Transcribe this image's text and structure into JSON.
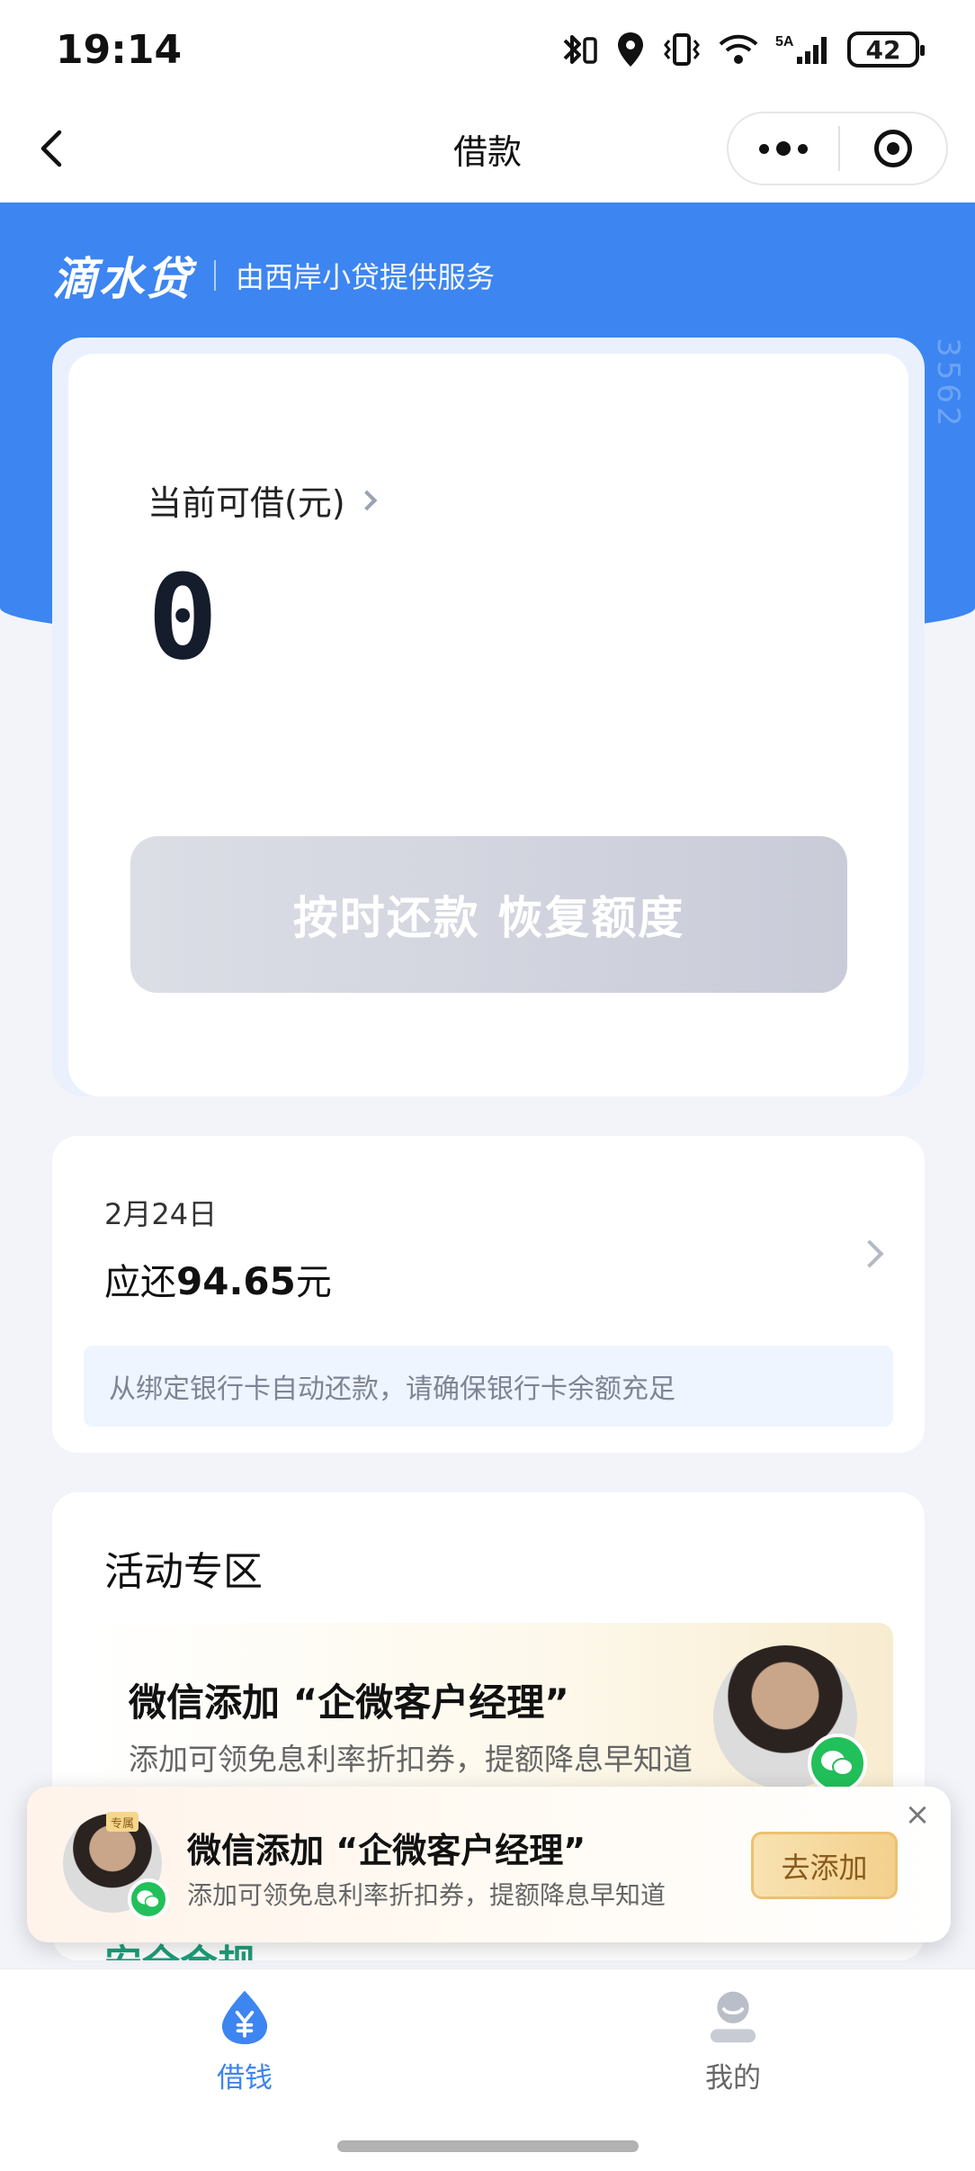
{
  "status_bar": {
    "time": "19:14",
    "battery_level": "42",
    "icons": [
      "bluetooth-icon",
      "location-icon",
      "vibrate-icon",
      "wifi-icon",
      "signal-5g-icon",
      "battery-icon"
    ],
    "network_label": "5A"
  },
  "nav": {
    "title": "借款",
    "back_icon": "chevron-left-icon",
    "more_icon": "more-dots-icon",
    "close_icon": "target-icon"
  },
  "header": {
    "brand_logo": "滴水贷",
    "brand_sub": "由西岸小贷提供服务",
    "watermark": "3562",
    "bg_color": "#3d85f0"
  },
  "credit": {
    "label": "当前可借(元)",
    "amount": "0",
    "button_label": "按时还款 恢复额度"
  },
  "bill": {
    "date": "2月24日",
    "due_prefix": "应还",
    "due_amount": "94.65",
    "due_suffix": "元",
    "note": "从绑定银行卡自动还款，请确保银行卡余额充足"
  },
  "activity": {
    "title": "活动专区",
    "promo_title": "微信添加 “企微客户经理”",
    "promo_sub": "添加可领免息利率折扣券，提额降息早知道",
    "next_section_title": "安全合规"
  },
  "popup": {
    "title": "微信添加 “企微客户经理”",
    "subtitle": "添加可领免息利率折扣券，提额降息早知道",
    "button_label": "去添加",
    "tag": "专属",
    "close_label": "×"
  },
  "tabs": [
    {
      "label": "借钱",
      "icon": "yuan-drop-icon",
      "active": true
    },
    {
      "label": "我的",
      "icon": "user-icon",
      "active": false
    }
  ],
  "colors": {
    "accent": "#3d85f0",
    "disabled_button": "#d2d5df",
    "gold_button": "#f3d08c",
    "green": "#22c05a"
  }
}
